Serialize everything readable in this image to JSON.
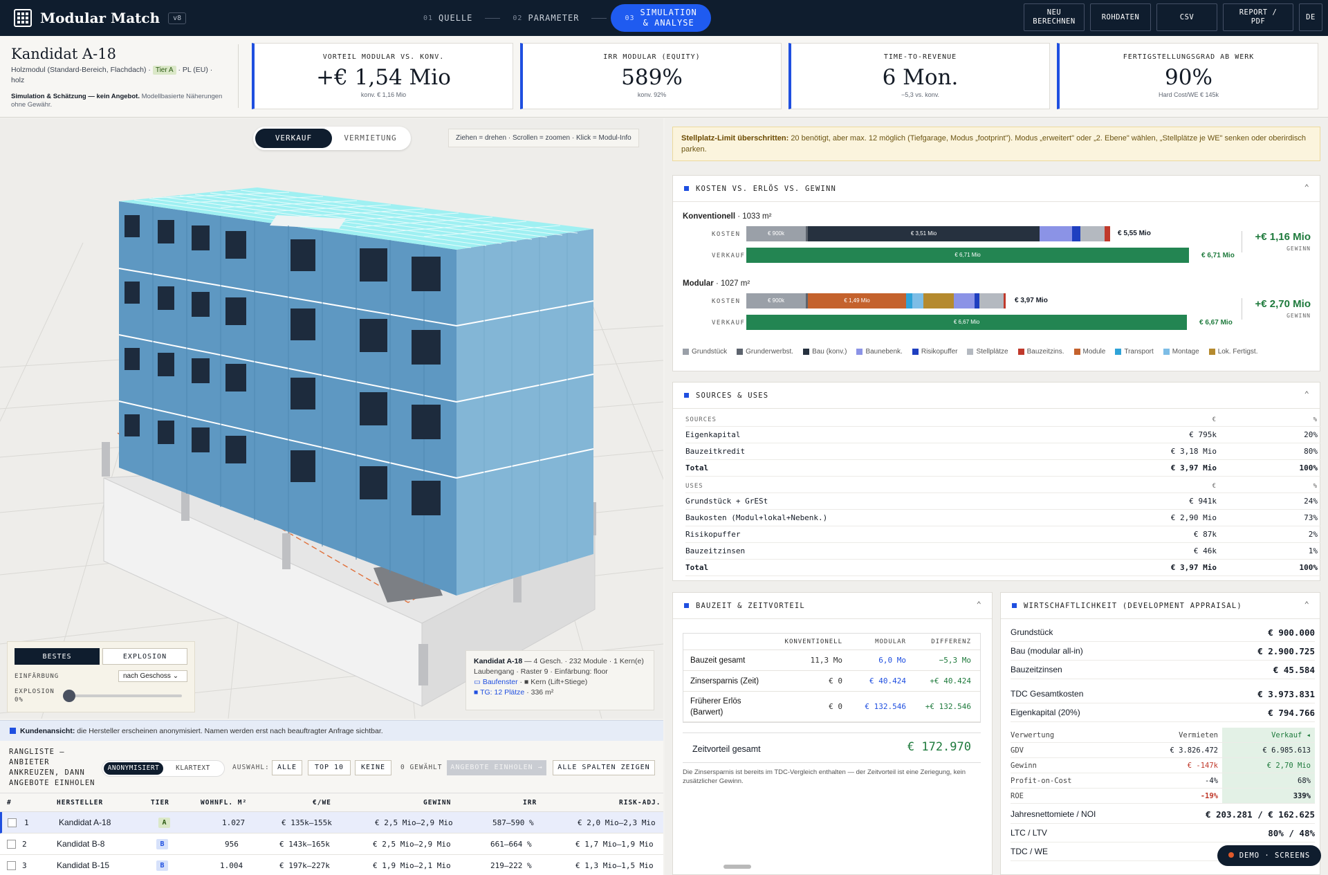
{
  "app": {
    "brand": "Modular Match",
    "version": "v8"
  },
  "steps": [
    {
      "num": "01",
      "label": "QUELLE"
    },
    {
      "num": "02",
      "label": "PARAMETER"
    },
    {
      "num": "03",
      "label": "SIMULATION",
      "label2": "& ANALYSE"
    }
  ],
  "top_buttons": [
    {
      "l1": "NEU",
      "l2": "BERECHNEN"
    },
    {
      "l1": "ROHDATEN",
      "l2": ""
    },
    {
      "l1": "CSV",
      "l2": ""
    },
    {
      "l1": "REPORT /",
      "l2": "PDF"
    },
    {
      "l1": "DE",
      "l2": ""
    }
  ],
  "candidate": {
    "title": "Kandidat A-18",
    "sub1": "Holzmodul (Standard-Bereich, Flachdach) ·",
    "tier": "Tier A",
    "sub2": "· PL (EU) ·",
    "sub3": "holz",
    "note_bold": "Simulation & Schätzung — kein Angebot.",
    "note": "Modellbasierte Näherungen ohne Gewähr."
  },
  "kpis": [
    {
      "label": "VORTEIL MODULAR VS. KONV.",
      "value": "+€ 1,54 Mio",
      "sub": "konv. € 1,16 Mio"
    },
    {
      "label": "IRR MODULAR (EQUITY)",
      "value": "589%",
      "sub": "konv. 92%"
    },
    {
      "label": "TIME-TO-REVENUE",
      "value": "6 Mon.",
      "sub": "−5,3 vs. konv."
    },
    {
      "label": "FERTIGSTELLUNGSGRAD AB WERK",
      "value": "90%",
      "sub": "Hard Cost/WE € 145k"
    }
  ],
  "viewer": {
    "mode": [
      "VERKAUF",
      "VERMIETUNG"
    ],
    "hint": "Ziehen = drehen · Scrollen = zoomen · Klick = Modul-Info",
    "seg": [
      "BESTES",
      "EXPLOSION"
    ],
    "color_label": "EINFÄRBUNG",
    "color_value": "nach Geschoss",
    "explosion_label": "EXPLOSION",
    "explosion_value": "0%",
    "explosion_level": 0,
    "info_title": "Kandidat A-18",
    "info_t1": "— 4 Gesch. · 232 Module · 1 Kern(e)",
    "info_l2": "Laubengang · Raster 9 · Einfärbung: floor",
    "info_baufenster": "Baufenster",
    "info_kern": "Kern (Lift+Stiege)",
    "info_tg": "TG: 12 Plätze",
    "info_tg2": "· 336 m²"
  },
  "notice": {
    "bold": "Kundenansicht:",
    "text": "die Hersteller erscheinen anonymisiert. Namen werden erst nach beauftragter Anfrage sichtbar."
  },
  "list": {
    "title": "RANGLISTE — ANBIETER ANKREUZEN, DANN ANGEBOTE EINHOLEN",
    "mode": [
      "ANONYMISIERT",
      "KLARTEXT"
    ],
    "select_label": "AUSWAHL:",
    "btns": [
      "ALLE",
      "TOP 10",
      "KEINE"
    ],
    "selected": "0 GEWÄHLT",
    "quote_btn": "ANGEBOTE EINHOLEN →",
    "cols_btn": "ALLE SPALTEN ZEIGEN",
    "headers": [
      "#",
      "HERSTELLER",
      "TIER",
      "WOHNFL. M²",
      "€/WE",
      "GEWINN",
      "IRR",
      "RISK-ADJ."
    ],
    "rows": [
      {
        "n": "1",
        "name": "Kandidat A-18",
        "tier": "A",
        "area": "1.027",
        "pwe": "€ 135k–155k",
        "gain": "€ 2,5 Mio–2,9 Mio",
        "irr": "587–590 %",
        "risk": "€ 2,0 Mio–2,3 Mio"
      },
      {
        "n": "2",
        "name": "Kandidat B-8",
        "tier": "B",
        "area": "956",
        "pwe": "€ 143k–165k",
        "gain": "€ 2,5 Mio–2,9 Mio",
        "irr": "661–664 %",
        "risk": "€ 1,7 Mio–1,9 Mio"
      },
      {
        "n": "3",
        "name": "Kandidat B-15",
        "tier": "B",
        "area": "1.004",
        "pwe": "€ 197k–227k",
        "gain": "€ 1,9 Mio–2,1 Mio",
        "irr": "219–222 %",
        "risk": "€ 1,3 Mio–1,5 Mio"
      }
    ]
  },
  "warning": {
    "bold": "Stellplatz-Limit überschritten:",
    "text": "20 benötigt, aber max. 12 möglich (Tiefgarage, Modus „footprint\"). Modus „erweitert\" oder „2. Ebene\" wählen, „Stellplätze je WE\" senken oder oberirdisch parken."
  },
  "cost_card": {
    "title": "KOSTEN VS. ERLÖS VS. GEWINN",
    "konv_title": "Konventionell",
    "konv_area": "· 1033 m²",
    "mod_title": "Modular",
    "mod_area": "· 1027 m²",
    "cost_lbl": "KOSTEN",
    "sale_lbl": "VERKAUF",
    "konv_cost": "€ 5,55 Mio",
    "konv_sale": "€ 6,71 Mio",
    "konv_sale_in": "€ 6,71 Mio",
    "konv_gain": "+€ 1,16 Mio",
    "mod_cost": "€ 3,97 Mio",
    "mod_sale": "€ 6,67 Mio",
    "mod_sale_in": "€ 6,67 Mio",
    "mod_gain": "+€ 2,70 Mio",
    "gain_lbl": "GEWINN",
    "seg_labels": {
      "g": "€ 900k",
      "k": "€ 3,51 Mio",
      "m": "€ 1,49 Mio"
    },
    "legend": [
      {
        "name": "Grundstück",
        "color": "#9aa0a8"
      },
      {
        "name": "Grunderwerbst.",
        "color": "#5d646e"
      },
      {
        "name": "Bau (konv.)",
        "color": "#26313f"
      },
      {
        "name": "Baunebenk.",
        "color": "#8b93e6"
      },
      {
        "name": "Risikopuffer",
        "color": "#1f3fc0"
      },
      {
        "name": "Stellplätze",
        "color": "#b4b9c0"
      },
      {
        "name": "Bauzeitzins.",
        "color": "#c0392b"
      },
      {
        "name": "Module",
        "color": "#c4622d"
      },
      {
        "name": "Transport",
        "color": "#2fa3d8"
      },
      {
        "name": "Montage",
        "color": "#7dbde6"
      },
      {
        "name": "Lok. Fertigst.",
        "color": "#b58a2e"
      }
    ]
  },
  "sources_uses": {
    "title": "SOURCES & USES",
    "sources_h": [
      "SOURCES",
      "€",
      "%"
    ],
    "sources": [
      {
        "n": "Eigenkapital",
        "v": "€ 795k",
        "p": "20%"
      },
      {
        "n": "Bauzeitkredit",
        "v": "€ 3,18 Mio",
        "p": "80%"
      }
    ],
    "sources_total": {
      "n": "Total",
      "v": "€ 3,97 Mio",
      "p": "100%"
    },
    "uses_h": [
      "USES",
      "€",
      "%"
    ],
    "uses": [
      {
        "n": "Grundstück + GrESt",
        "v": "€ 941k",
        "p": "24%"
      },
      {
        "n": "Baukosten (Modul+lokal+Nebenk.)",
        "v": "€ 2,90 Mio",
        "p": "73%"
      },
      {
        "n": "Risikopuffer",
        "v": "€ 87k",
        "p": "2%"
      },
      {
        "n": "Bauzeitzinsen",
        "v": "€ 46k",
        "p": "1%"
      }
    ],
    "uses_total": {
      "n": "Total",
      "v": "€ 3,97 Mio",
      "p": "100%"
    }
  },
  "bauzeit": {
    "title": "BAUZEIT & ZEITVORTEIL",
    "h": [
      "",
      "KONVENTIONELL",
      "MODULAR",
      "DIFFERENZ"
    ],
    "rows": [
      {
        "n": "Bauzeit gesamt",
        "k": "11,3 Mo",
        "m": "6,0 Mo",
        "d": "−5,3 Mo"
      },
      {
        "n": "Zinsersparnis (Zeit)",
        "k": "€ 0",
        "m": "€ 40.424",
        "d": "+€ 40.424"
      },
      {
        "n": "Früherer Erlös (Barwert)",
        "k": "€ 0",
        "m": "€ 132.546",
        "d": "+€ 132.546"
      }
    ],
    "total_lbl": "Zeitvorteil gesamt",
    "total": "€ 172.970",
    "note": "Die Zinsersparnis ist bereits im TDC-Vergleich enthalten — der Zeitvorteil ist eine Zeriegung, kein zusätzlicher Gewinn."
  },
  "wirtschaft": {
    "title": "WIRTSCHAFTLICHKEIT (DEVELOPMENT APPRAISAL)",
    "rows1": [
      {
        "n": "Grundstück",
        "v": "€ 900.000"
      },
      {
        "n": "Bau (modular all-in)",
        "v": "€ 2.900.725"
      },
      {
        "n": "Bauzeitzinsen",
        "v": "€ 45.584"
      }
    ],
    "rows2": [
      {
        "n": "TDC Gesamtkosten",
        "v": "€ 3.973.831"
      },
      {
        "n": "Eigenkapital (20%)",
        "v": "€ 794.766"
      }
    ],
    "vh": [
      "Verwertung",
      "Vermieten",
      "Verkauf ◂"
    ],
    "vrows": [
      {
        "n": "GDV",
        "a": "€ 3.826.472",
        "b": "€ 6.985.613"
      },
      {
        "n": "Gewinn",
        "a": "€ -147k",
        "b": "€ 2,70 Mio"
      },
      {
        "n": "Profit-on-Cost",
        "a": "-4%",
        "b": "68%"
      },
      {
        "n": "ROE",
        "a": "-19%",
        "b": "339%"
      }
    ],
    "rows3": [
      {
        "n": "Jahresnettomiete / NOI",
        "v": "€ 203.281 / € 162.625"
      },
      {
        "n": "LTC / LTV",
        "v": "80% / 48%"
      },
      {
        "n": "TDC / WE",
        "v": "€ 1"
      }
    ]
  },
  "demo": "DEMO · SCREENS"
}
